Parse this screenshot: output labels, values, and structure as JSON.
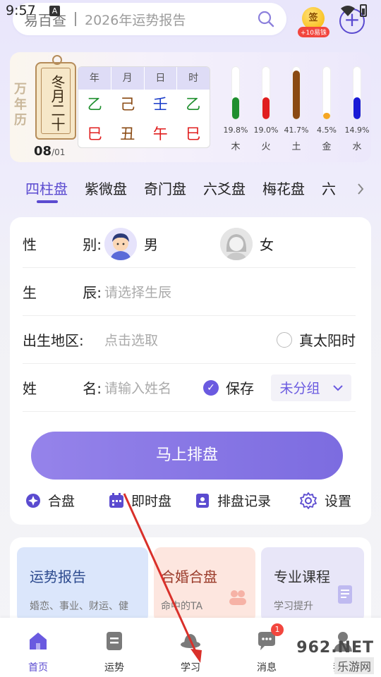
{
  "status_bar": {
    "time": "9:57",
    "indicator": "A"
  },
  "search": {
    "brand": "易百查",
    "placeholder": "2026年运势报告"
  },
  "signin": {
    "label": "签",
    "badge": "+10易铢"
  },
  "calendar": {
    "side_label": "万年历",
    "lunar_date": "冬月二十",
    "day": "08",
    "month": "/01",
    "pillar_headers": [
      "年",
      "月",
      "日",
      "时"
    ],
    "stems": [
      {
        "char": "乙",
        "color": "#1f8f2e"
      },
      {
        "char": "己",
        "color": "#8a4a13"
      },
      {
        "char": "壬",
        "color": "#1a3cc9"
      },
      {
        "char": "乙",
        "color": "#1f8f2e"
      }
    ],
    "branches": [
      {
        "char": "巳",
        "color": "#e01e1e"
      },
      {
        "char": "丑",
        "color": "#8a4a13"
      },
      {
        "char": "午",
        "color": "#e01e1e"
      },
      {
        "char": "巳",
        "color": "#e01e1e"
      }
    ],
    "elements": [
      {
        "name": "木",
        "pct": "19.8%",
        "value": 19.8,
        "color": "#1f8f2e"
      },
      {
        "name": "火",
        "pct": "19.0%",
        "value": 19.0,
        "color": "#e01e1e"
      },
      {
        "name": "土",
        "pct": "41.7%",
        "value": 41.7,
        "color": "#8a4a13"
      },
      {
        "name": "金",
        "pct": "4.5%",
        "value": 4.5,
        "color": "#f5a623"
      },
      {
        "name": "水",
        "pct": "14.9%",
        "value": 14.9,
        "color": "#1a1ad6"
      }
    ]
  },
  "tabs": [
    "四柱盘",
    "紫微盘",
    "奇门盘",
    "六爻盘",
    "梅花盘",
    "六"
  ],
  "form": {
    "gender_label": [
      "性",
      "别:"
    ],
    "male": "男",
    "female": "女",
    "birth_label": [
      "生",
      "辰:"
    ],
    "birth_placeholder": "请选择生辰",
    "place_label": "出生地区:",
    "place_placeholder": "点击选取",
    "true_solar": "真太阳时",
    "name_label": [
      "姓",
      "名:"
    ],
    "name_placeholder": "请输入姓名",
    "save": "保存",
    "group": "未分组",
    "submit": "马上排盘"
  },
  "quick_actions": [
    "合盘",
    "即时盘",
    "排盘记录",
    "设置"
  ],
  "features": [
    {
      "title": "运势报告",
      "sub": "婚恋、事业、财运、健"
    },
    {
      "title": "合婚合盘",
      "sub": "命中的TA"
    },
    {
      "title": "专业课程",
      "sub": "学习提升"
    }
  ],
  "bottom_nav": [
    {
      "label": "首页"
    },
    {
      "label": "运势"
    },
    {
      "label": "学习"
    },
    {
      "label": "消息",
      "badge": "1"
    },
    {
      "label": "我的"
    }
  ],
  "watermark": {
    "main": "962.NET",
    "sub": "乐游网"
  },
  "colors": {
    "accent": "#5b4bd0",
    "button": "#8675e6"
  }
}
